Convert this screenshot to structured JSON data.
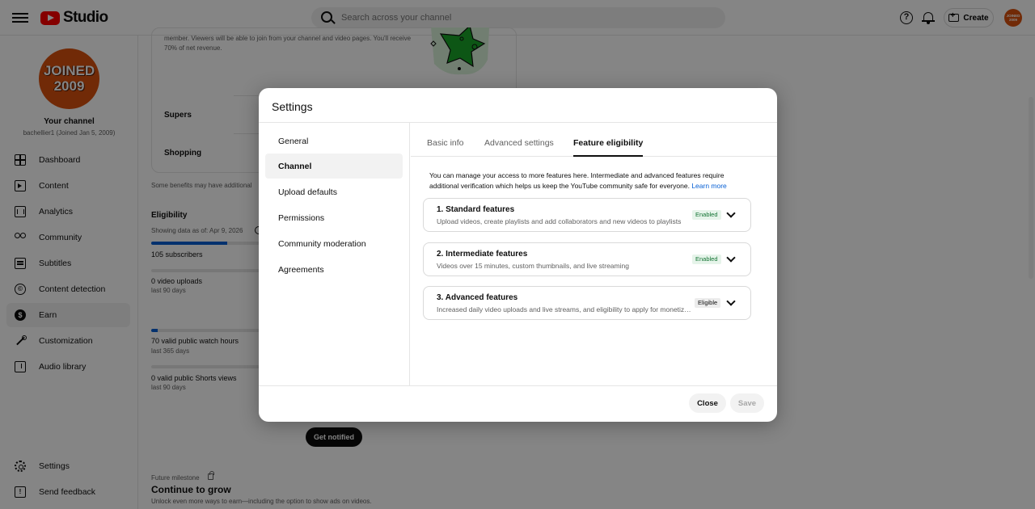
{
  "header": {
    "logo_text": "Studio",
    "search_placeholder": "Search across your channel",
    "help_glyph": "?",
    "create_label": "Create",
    "avatar_text": "JOINED 2009"
  },
  "sidebar": {
    "avatar_line1": "JOINED",
    "avatar_line2": "2009",
    "channel_title": "Your channel",
    "channel_sub": "bachellier1 (Joined Jan 5, 2009)",
    "items": [
      {
        "label": "Dashboard",
        "icon": "dashboard-icon"
      },
      {
        "label": "Content",
        "icon": "content-icon"
      },
      {
        "label": "Analytics",
        "icon": "analytics-icon"
      },
      {
        "label": "Community",
        "icon": "community-icon"
      },
      {
        "label": "Subtitles",
        "icon": "subtitles-icon"
      },
      {
        "label": "Content detection",
        "icon": "copyright-icon"
      },
      {
        "label": "Earn",
        "icon": "earn-icon",
        "active": true
      },
      {
        "label": "Customization",
        "icon": "customization-icon"
      },
      {
        "label": "Audio library",
        "icon": "audio-library-icon"
      }
    ],
    "bottom_items": [
      {
        "label": "Settings",
        "icon": "gear-icon"
      },
      {
        "label": "Send feedback",
        "icon": "feedback-icon"
      }
    ],
    "copyright_glyph": "©",
    "earn_glyph": "$",
    "feedback_glyph": "!"
  },
  "main": {
    "card_text": "member. Viewers will be able to join from your channel and video pages. You'll receive 70% of net revenue.",
    "supers": "Supers",
    "shopping": "Shopping",
    "benefits": "Some benefits may have additional",
    "eligibility": "Eligibility",
    "showing": "Showing data as of: Apr 9, 2026",
    "metrics": [
      {
        "label": "105 subscribers",
        "sub": "",
        "progress": 0.47
      },
      {
        "label": "0 video uploads",
        "sub": "last 90 days",
        "progress": 0
      },
      {
        "label": "70 valid public watch hours",
        "sub": "last 365 days",
        "progress": 0.04
      },
      {
        "label": "0 valid public Shorts views",
        "sub": "last 90 days",
        "progress": 0
      }
    ],
    "get_notified": "Get notified",
    "future_milestone": "Future milestone",
    "continue_title": "Continue to grow",
    "unlock_text": "Unlock even more ways to earn—including the option to show ads on videos."
  },
  "dialog": {
    "title": "Settings",
    "nav": [
      {
        "label": "General"
      },
      {
        "label": "Channel",
        "active": true
      },
      {
        "label": "Upload defaults"
      },
      {
        "label": "Permissions"
      },
      {
        "label": "Community moderation"
      },
      {
        "label": "Agreements"
      }
    ],
    "tabs": [
      {
        "label": "Basic info"
      },
      {
        "label": "Advanced settings"
      },
      {
        "label": "Feature eligibility",
        "active": true
      }
    ],
    "description": "You can manage your access to more features here. Intermediate and advanced features require additional verification which helps us keep the YouTube community safe for everyone.",
    "learn_more": "Learn more",
    "features": [
      {
        "name": "1. Standard features",
        "sub": "Upload videos, create playlists and add collaborators and new videos to playlists",
        "status": "Enabled"
      },
      {
        "name": "2. Intermediate features",
        "sub": "Videos over 15 minutes, custom thumbnails, and live streaming",
        "status": "Enabled"
      },
      {
        "name": "3. Advanced features",
        "sub": "Increased daily video uploads and live streams, and eligibility to apply for monetization",
        "status": "Eligible"
      }
    ],
    "close_label": "Close",
    "save_label": "Save"
  },
  "colors": {
    "brand_red": "#ff0000",
    "link_blue": "#065fd4",
    "enabled_green": "#137333",
    "avatar_orange": "#d9520e"
  }
}
